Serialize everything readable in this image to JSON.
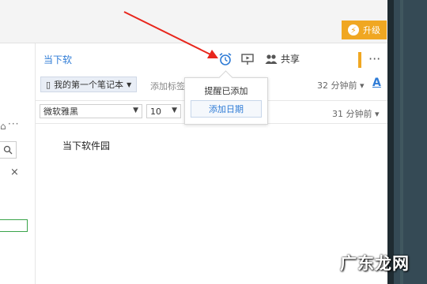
{
  "topbar": {
    "upgrade_label": "升级",
    "upgrade_icon": "lightning-icon"
  },
  "note": {
    "title": "当下软",
    "share_label": "共享",
    "more": "···",
    "notebook_label": "我的第一个笔记本",
    "add_tag": "添加标签",
    "edited_time": "32 分钟前",
    "font_icon": "A",
    "font_family": "微软雅黑",
    "font_size": "10",
    "created_time": "31 分钟前",
    "body_text": "当下软件园"
  },
  "reminder_popover": {
    "message": "提醒已添加",
    "add_date_button": "添加日期"
  },
  "sidebar": {
    "close": "×"
  },
  "watermark": "广东龙网",
  "colors": {
    "accent": "#2e7bd6",
    "upgrade": "#f0a722",
    "arrow": "#e8261c"
  }
}
